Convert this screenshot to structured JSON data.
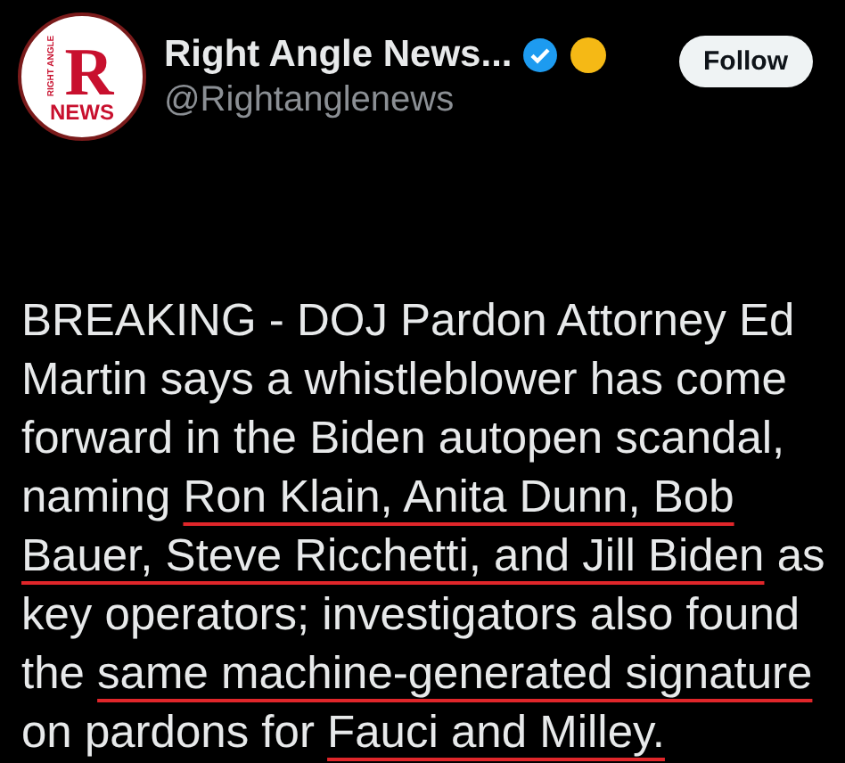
{
  "header": {
    "avatar": {
      "letter": "R",
      "top": "RIGHT ANGLE",
      "bottom": "NEWS"
    },
    "name": "Right Angle News...",
    "verified": true,
    "handle": "@Rightanglenews",
    "follow_button": "Follow"
  },
  "tweet": {
    "lines": [
      [
        {
          "text": "BREAKING - DOJ Pardon Attorney Ed",
          "underlined": false
        }
      ],
      [
        {
          "text": "Martin says a whistleblower has come",
          "underlined": false
        }
      ],
      [
        {
          "text": "forward in the Biden autopen scandal,",
          "underlined": false
        }
      ],
      [
        {
          "text": "naming ",
          "underlined": false
        },
        {
          "text": "Ron Klain, Anita Dunn, Bob",
          "underlined": true
        }
      ],
      [
        {
          "text": "Bauer, Steve Ricchetti, and Jill Biden",
          "underlined": true
        },
        {
          "text": " as",
          "underlined": false
        }
      ],
      [
        {
          "text": "key operators; investigators also found",
          "underlined": false
        }
      ],
      [
        {
          "text": "the ",
          "underlined": false
        },
        {
          "text": "same machine-generated signature",
          "underlined": true
        }
      ],
      [
        {
          "text": "on pardons for ",
          "underlined": false
        },
        {
          "text": "Fauci and Milley.",
          "underlined": true
        }
      ]
    ]
  }
}
